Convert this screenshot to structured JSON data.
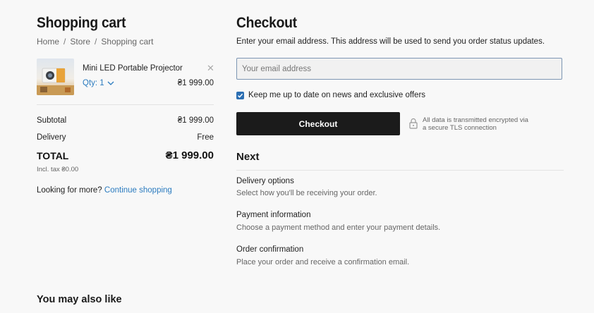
{
  "cart": {
    "title": "Shopping cart",
    "breadcrumb": [
      "Home",
      "Store",
      "Shopping cart"
    ],
    "item": {
      "name": "Mini LED Portable Projector",
      "qty_label": "Qty: 1",
      "price": "₴1 999.00"
    },
    "subtotal_label": "Subtotal",
    "subtotal_value": "₴1 999.00",
    "delivery_label": "Delivery",
    "delivery_value": "Free",
    "total_label": "TOTAL",
    "total_value": "₴1 999.00",
    "tax_note": "Incl. tax ₴0.00",
    "more_text": "Looking for more?",
    "continue_link": "Continue shopping"
  },
  "checkout": {
    "title": "Checkout",
    "intro": "Enter your email address. This address will be used to send you order status updates.",
    "email_placeholder": "Your email address",
    "newsletter_label": "Keep me up to date on news and exclusive offers",
    "newsletter_checked": true,
    "button_label": "Checkout",
    "security_line1": "All data is transmitted encrypted via",
    "security_line2": "a secure TLS connection",
    "next_title": "Next",
    "steps": [
      {
        "title": "Delivery options",
        "desc": "Select how you'll be receiving your order."
      },
      {
        "title": "Payment information",
        "desc": "Choose a payment method and enter your payment details."
      },
      {
        "title": "Order confirmation",
        "desc": "Place your order and receive a confirmation email."
      }
    ]
  },
  "related": {
    "title": "You may also like"
  },
  "colors": {
    "accent": "#2c6fb3",
    "link": "#2b7bbf",
    "button": "#1b1b1b",
    "background": "#f8f8f8"
  }
}
